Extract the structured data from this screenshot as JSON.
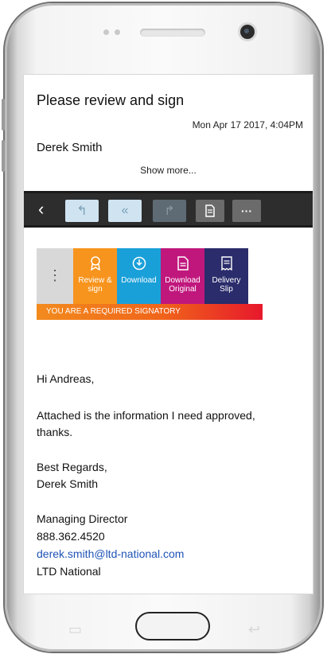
{
  "email": {
    "subject": "Please review and sign",
    "date": "Mon Apr 17 2017, 4:04PM",
    "sender": "Derek Smith",
    "show_more": "Show more..."
  },
  "toolbar": {
    "back_icon": "chevron-left-icon",
    "reply_icon": "reply-icon",
    "reply_all_icon": "reply-all-icon",
    "forward_icon": "forward-icon",
    "document_icon": "document-icon",
    "more_label": "···"
  },
  "actions": {
    "menu_label": "⋮",
    "items": [
      {
        "label": "Review & sign",
        "color": "#f7941d",
        "icon": "ribbon-icon"
      },
      {
        "label": "Download",
        "color": "#1aa0d9",
        "icon": "download-icon"
      },
      {
        "label": "Download Original",
        "color": "#c0177d",
        "icon": "document-icon"
      },
      {
        "label": "Delivery Slip",
        "color": "#2a2c6b",
        "icon": "receipt-icon"
      }
    ],
    "banner": "YOU ARE A REQUIRED SIGNATORY"
  },
  "body": {
    "greeting": "Hi Andreas,",
    "line1": "Attached is the information I need approved,",
    "line2": "thanks.",
    "regards": "Best Regards,",
    "sig_name": "Derek Smith",
    "title": "Managing Director",
    "phone": "888.362.4520",
    "email": "derek.smith@ltd-national.com",
    "company": "LTD National"
  },
  "colors": {
    "link": "#1f53b6",
    "toolbar": "#2d2d2d",
    "banner_start": "#f28b1e",
    "banner_end": "#e7182c"
  }
}
